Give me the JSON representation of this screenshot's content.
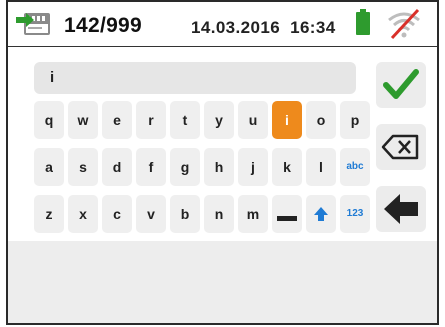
{
  "status": {
    "counter": "142/999",
    "date": "14.03.2016",
    "time": "16:34",
    "icons": {
      "memory": "sd-card-arrow-icon",
      "battery": "battery-full-icon",
      "wifi": "wifi-off-icon"
    },
    "colors": {
      "battery": "#2e9b2e",
      "wifi_slash": "#d9302a",
      "wifi_arcs": "#bdbdbd"
    }
  },
  "input": {
    "value": "i"
  },
  "keyboard": {
    "active_key": "i",
    "active_color": "#ee8a1c",
    "rows": [
      [
        "q",
        "w",
        "e",
        "r",
        "t",
        "y",
        "u",
        "i",
        "o",
        "p"
      ],
      [
        "a",
        "s",
        "d",
        "f",
        "g",
        "h",
        "j",
        "k",
        "l",
        "abc"
      ],
      [
        "z",
        "x",
        "c",
        "v",
        "b",
        "n",
        "m",
        "space",
        "shift",
        "123"
      ]
    ],
    "mode_labels": {
      "letters": "abc",
      "numbers": "123"
    }
  },
  "actions": {
    "confirm_icon": "check-icon",
    "confirm_color": "#2e9b2e",
    "delete_icon": "backspace-icon",
    "back_icon": "back-arrow-icon"
  }
}
